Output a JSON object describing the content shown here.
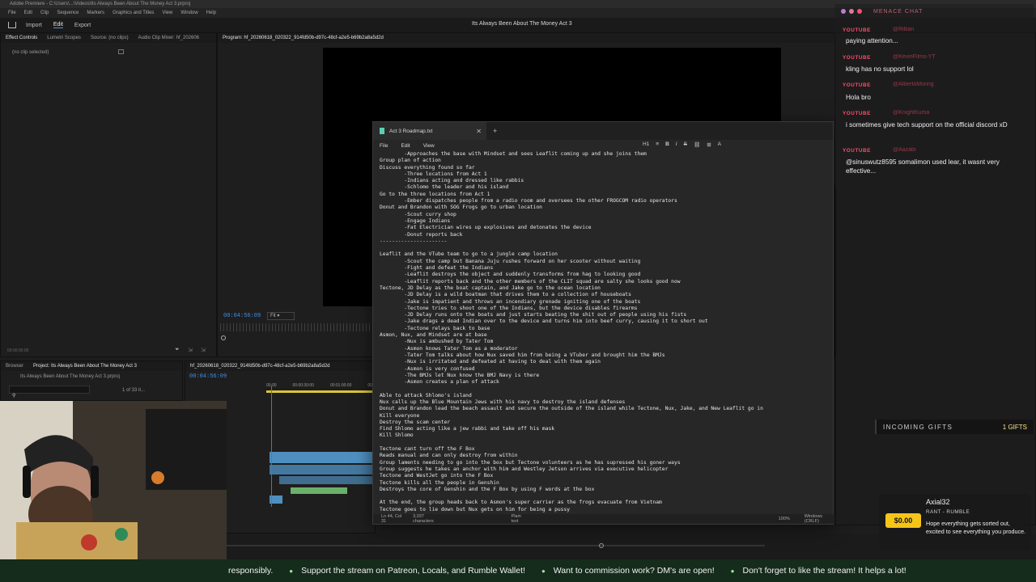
{
  "os_title": "Adobe Premiere - C:\\Users\\...\\Videos\\Its Always Been About The Money Act 3.prproj",
  "menu": [
    "File",
    "Edit",
    "Clip",
    "Sequence",
    "Markers",
    "Graphics and Titles",
    "View",
    "Window",
    "Help"
  ],
  "workspace": {
    "tabs": [
      "Import",
      "Edit",
      "Export"
    ],
    "active": "Edit",
    "title": "Its Always Been About The Money Act 3"
  },
  "left_panel": {
    "tabs": [
      "Effect Controls",
      "Lumetri Scopes",
      "Source: (no clips)",
      "Audio Clip Mixer: hf_202606"
    ],
    "empty_text": "(no clip selected)",
    "timecode": "00:00:00:00"
  },
  "program": {
    "tab": "Program: hf_20260618_020322_914fd50b-d97c-48cf-a2e5-b69b2a8a5d2d",
    "timecode": "00:04:56:09",
    "fit": "Fit"
  },
  "project_panel": {
    "tabs": [
      "Browser",
      "Project: Its Always Been About The Money Act 3"
    ],
    "item": "Its Always Been About The Money Act 3.prproj",
    "count": "1 of 33 it..."
  },
  "timeline": {
    "tab": "hf_20260618_020322_914fd50b-d97c-48cf-a2e5-b69b2a8a5d2d",
    "timecode": "00:04:56:09",
    "ruler_labels": [
      "00:00",
      "00:00:30:00",
      "00:01:00:00",
      "00:01:30:00"
    ]
  },
  "notepad": {
    "tab_title": "Act 3 Roadmap.txt",
    "menu": [
      "File",
      "Edit",
      "View"
    ],
    "tools": [
      "H1",
      "≡",
      "B",
      "I",
      "S",
      "⛓",
      "⊞",
      "A"
    ],
    "lines": [
      "        -Approaches the base with Mindset and sees Leaflit coming up and she joins them",
      "Group plan of action",
      "Discuss everything found so far",
      "        -Three locations from Act 1",
      "        -Indians acting and dressed like rabbis",
      "        -Schlomo the leader and his island",
      "Go to the three locations from Act 1",
      "        -Ember dispatches people from a radio room and oversees the other FROGCOM radio operators",
      "Donut and Brandon with SOG Frogs go to urban location",
      "        -Scout curry shop",
      "        -Engage Indians",
      "        -Fat Electrician wires up explosives and detonates the device",
      "        -Donut reports back",
      "----------------------",
      "",
      "Leaflit and the VTube team to go to a jungle camp location",
      "        -Scout the camp but Banana Juju rushes forward on her scooter without waiting",
      "        -Fight and defeat the Indians",
      "        -Leaflit destroys the object and suddenly transforms from hag to looking good",
      "        -Leaflit reports back and the other members of the CLIT squad are salty she looks good now",
      "Tectone, JD Delay as the boat captain, and Jake go to the ocean location",
      "        -JD Delay is a wild boatman that drives them to a collection of houseboats",
      "        -Jake is impatient and throws an incendiary grenade igniting one of the boats",
      "        -Tectone tries to shoot one of the Indians, but the device disables firearms",
      "        -JD Delay runs onto the boats and just starts beating the shit out of people using his fists",
      "        -Jake drags a dead Indian over to the device and turns him into beef curry, causing it to short out",
      "        -Tectone relays back to base",
      "Asmon, Nux, and Mindset are at base",
      "        -Nux is ambushed by Tater Tom",
      "        -Asmon knows Tater Tom as a moderator",
      "        -Tater Tom talks about how Nux saved him from being a VTuber and brought him the BMJs",
      "        -Nux is irritated and defeated at having to deal with them again",
      "        -Asmon is very confused",
      "        -The BMJs let Nux know the BMJ Navy is there",
      "        -Asmon creates a plan of attack",
      "",
      "Able to attack Shlomo's island",
      "Nux calls up the Blue Mountain Jews with his navy to destroy the island defenses",
      "Donut and Brandon lead the beach assault and secure the outside of the island while Tectone, Nux, Jake, and New Leaflit go in",
      "Kill everyone",
      "Destroy the scam center",
      "Find Shlomo acting like a jew rabbi and take off his mask",
      "Kill Shlomo",
      "",
      "Tectone cant turn off the F Box",
      "Reads manual and can only destroy from within",
      "Group laments needing to go into the box but Tectone volunteers as he has supressed his goner ways",
      "Group suggests he takes an anchor with him and Westley Jetson arrives via executive helicopter",
      "Tectone and WestJet go into the F Box",
      "Tectone kills all the people in Genshin",
      "Destroys the core of Genshin and the F Box by using F words at the box",
      "",
      "At the end, the group heads back to Asmon's super carrier as the frogs evacuate from Vietnam",
      "Tectone goes to lie down but Nux gets on him for being a pussy"
    ],
    "status": [
      "Ln 44, Col 31",
      "3,037 characters",
      "Plain text",
      "100%",
      "Windows (CRLF)",
      "UTF-8"
    ]
  },
  "chat": {
    "title": "MENACE CHAT",
    "platform_label": "YOUTUBE",
    "messages": [
      {
        "user": "@Rillian",
        "text": "paying attention..."
      },
      {
        "user": "@KevinFilms-YT",
        "text": "kling has no support lol"
      },
      {
        "user": "@AlbertoMoring",
        "text": "Hola bro"
      },
      {
        "user": "@KnightKuma",
        "text": "i sometimes give tech support on the official discord xD"
      },
      {
        "user": "@Aazabi",
        "text": "@sinuswutz8595 somalimon used lear, it wasnt very effective..."
      }
    ]
  },
  "gifts": {
    "title": "INCOMING GIFTS",
    "count": "1 GIFTS"
  },
  "rumble_alert": {
    "name": "Axial32",
    "source": "RANT - RUMBLE",
    "amount": "$0.00",
    "text": "Hope everything gets sorted out, excited to see everything you produce."
  },
  "ticker": [
    "responsibly.",
    "Support the stream on Patreon, Locals, and Rumble Wallet!",
    "Want to commission work? DM's are open!",
    "Don't forget to like the stream! It helps a lot!"
  ],
  "colors": {
    "accent_blue": "#3f8fe8",
    "chat_red": "#ff4d6d",
    "ticker_bg": "#152b1c",
    "rant_yellow": "#f5c518"
  }
}
